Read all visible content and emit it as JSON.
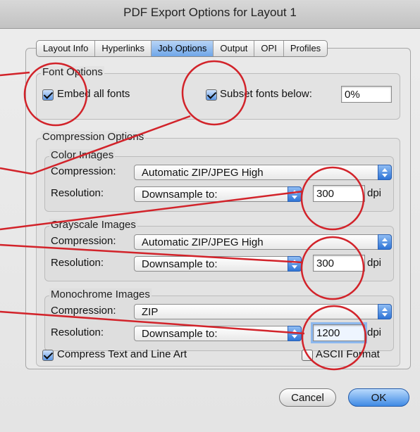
{
  "window": {
    "title": "PDF Export Options for Layout 1"
  },
  "tabs": [
    "Layout Info",
    "Hyperlinks",
    "Job Options",
    "Output",
    "OPI",
    "Profiles"
  ],
  "font_options": {
    "title": "Font Options",
    "embed_all_fonts": {
      "label": "Embed all fonts",
      "checked": true
    },
    "subset_fonts": {
      "label": "Subset fonts below:",
      "checked": true,
      "value": "0%"
    }
  },
  "compression": {
    "title": "Compression Options",
    "compression_label": "Compression:",
    "resolution_label": "Resolution:",
    "dpi_label": "dpi",
    "color": {
      "title": "Color Images",
      "compression": "Automatic ZIP/JPEG High",
      "resolution": "Downsample to:",
      "dpi": "300"
    },
    "grayscale": {
      "title": "Grayscale Images",
      "compression": "Automatic ZIP/JPEG High",
      "resolution": "Downsample to:",
      "dpi": "300"
    },
    "mono": {
      "title": "Monochrome Images",
      "compression": "ZIP",
      "resolution": "Downsample to:",
      "dpi": "1200"
    },
    "compress_text": {
      "label": "Compress Text and Line Art",
      "checked": true
    },
    "ascii_format": {
      "label": "ASCII Format",
      "checked": false
    }
  },
  "buttons": {
    "cancel": "Cancel",
    "ok": "OK"
  },
  "colors": {
    "accent": "#3f8ae4",
    "annotation": "#d2232a"
  }
}
